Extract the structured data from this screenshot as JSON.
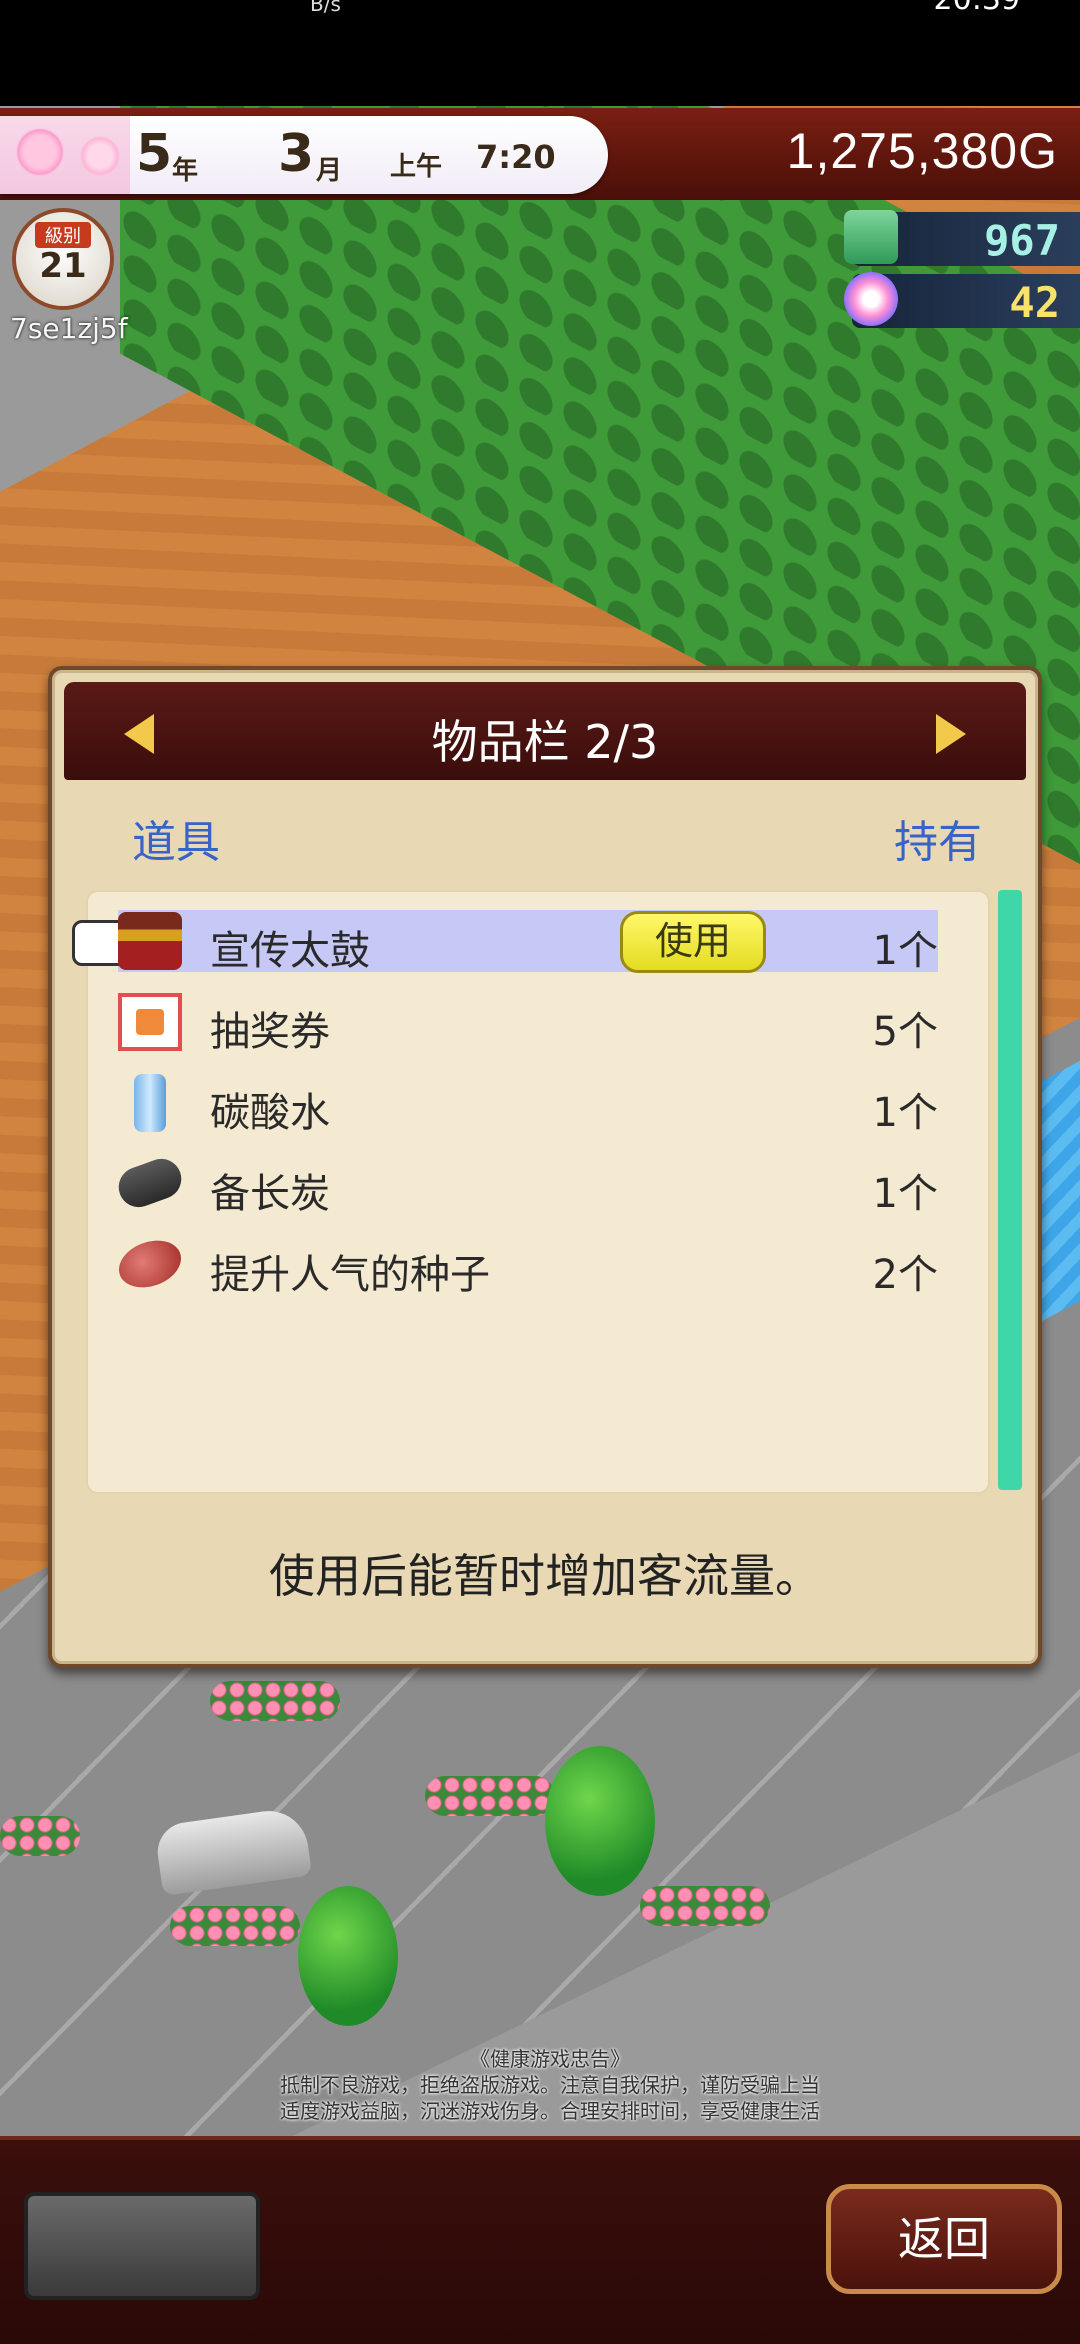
{
  "status_bar": {
    "time": "20:39",
    "network_speed_unit": "B/s"
  },
  "hud": {
    "year": "5",
    "year_unit": "年",
    "month": "3",
    "month_unit": "月",
    "period": "上午",
    "clock": "7:20",
    "money": "1,275,380G",
    "level_label": "級别",
    "level": "21",
    "player_id": "7se1zj5f",
    "resource_1": "967",
    "resource_2": "42"
  },
  "inventory": {
    "title": "物品栏 2/3",
    "column_item": "道具",
    "column_hold": "持有",
    "use_button": "使用",
    "items": [
      {
        "name": "宣传太鼓",
        "count": "1个",
        "icon": "drum-icon"
      },
      {
        "name": "抽奖券",
        "count": "5个",
        "icon": "lottery-ticket-icon"
      },
      {
        "name": "碳酸水",
        "count": "1个",
        "icon": "soda-bottle-icon"
      },
      {
        "name": "备长炭",
        "count": "1个",
        "icon": "charcoal-icon"
      },
      {
        "name": "提升人气的种子",
        "count": "2个",
        "icon": "seed-icon"
      }
    ],
    "description": "使用后能暂时增加客流量。"
  },
  "health_notice": {
    "title": "《健康游戏忠告》",
    "line1": "抵制不良游戏，拒绝盗版游戏。注意自我保护，谨防受骗上当",
    "line2": "适度游戏益脑，沉迷游戏伤身。合理安排时间，享受健康生活"
  },
  "bottom_bar": {
    "back_label": "返回"
  }
}
